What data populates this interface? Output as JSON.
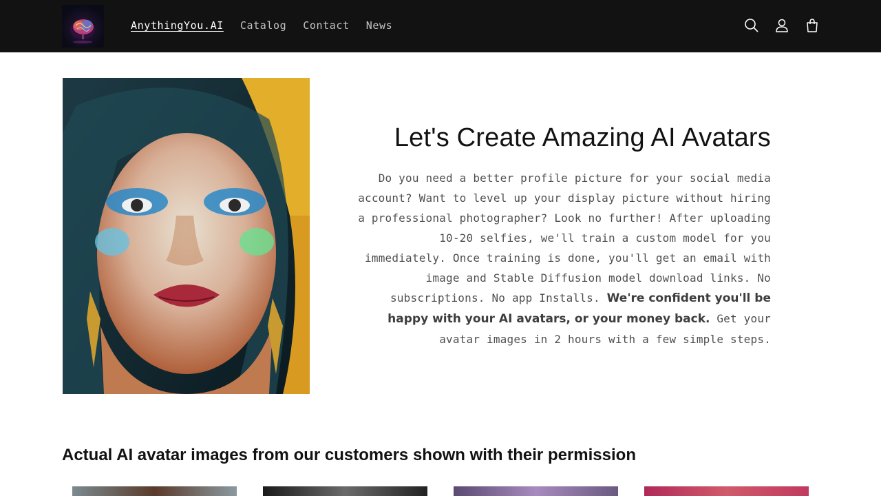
{
  "header": {
    "logo_alt": "AnythingYou.AI brain logo",
    "nav": [
      {
        "label": "AnythingYou.AI",
        "active": true
      },
      {
        "label": "Catalog",
        "active": false
      },
      {
        "label": "Contact",
        "active": false
      },
      {
        "label": "News",
        "active": false
      }
    ],
    "icons": [
      "search-icon",
      "account-icon",
      "cart-icon"
    ]
  },
  "hero": {
    "title": "Let's Create Amazing AI Avatars",
    "text_part1": "Do you need a better profile picture for your social media account? Want to level up your display picture without hiring a professional photographer? Look no further! After uploading 10-20 selfies, we'll train a custom model for you immediately. Once training is done, you'll get an email with image and Stable Diffusion model download links. No subscriptions. No app Installs. ",
    "text_bold": "We're confident you'll be happy with your AI avatars, or your money back.",
    "text_part2": " Get your avatar images in 2 hours with a few simple steps."
  },
  "gallery": {
    "title": "Actual AI avatar images from our customers shown with their permission",
    "thumbnail_count": 4
  },
  "colors": {
    "header_bg": "#121212",
    "page_bg": "#ffffff",
    "text": "#121212"
  }
}
